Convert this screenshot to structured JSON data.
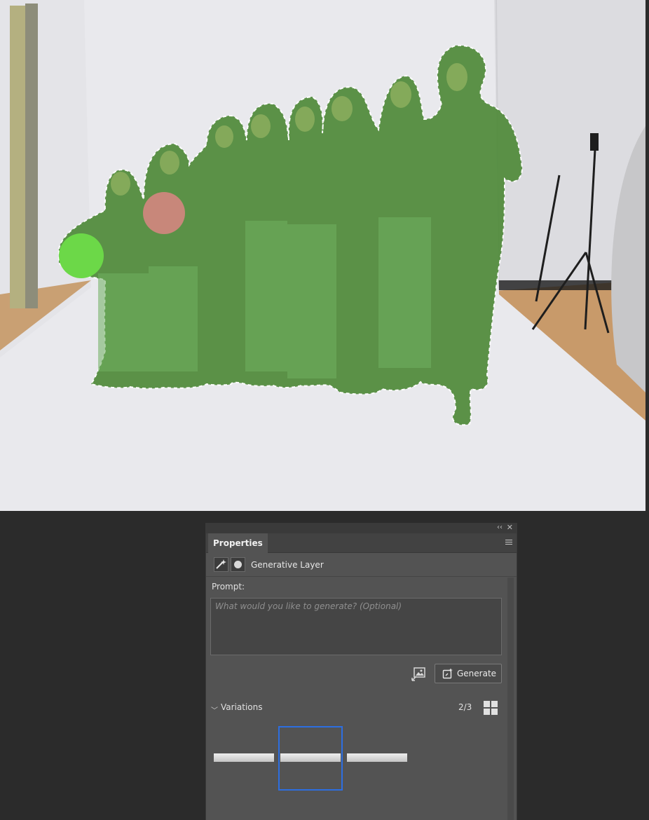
{
  "window": {
    "collapse_icon": "double-chevron-left-icon",
    "close_icon": "close-icon"
  },
  "panel": {
    "tab_label": "Properties",
    "menu_icon": "panel-menu-icon",
    "layer_type_label": "Generative Layer",
    "prompt_label": "Prompt:",
    "prompt_value": "",
    "prompt_placeholder": "What would you like to generate? (Optional)",
    "generate_label": "Generate",
    "variations_label": "Variations",
    "variations_count": "2/3",
    "variations": [
      {
        "index": 1,
        "selected": false
      },
      {
        "index": 2,
        "selected": true
      },
      {
        "index": 3,
        "selected": false
      }
    ]
  },
  "colors": {
    "selection_overlay": "#5a9a3a",
    "accent_selected": "#2d6ee0",
    "panel_bg": "#535353",
    "app_bg": "#2b2b2b"
  }
}
